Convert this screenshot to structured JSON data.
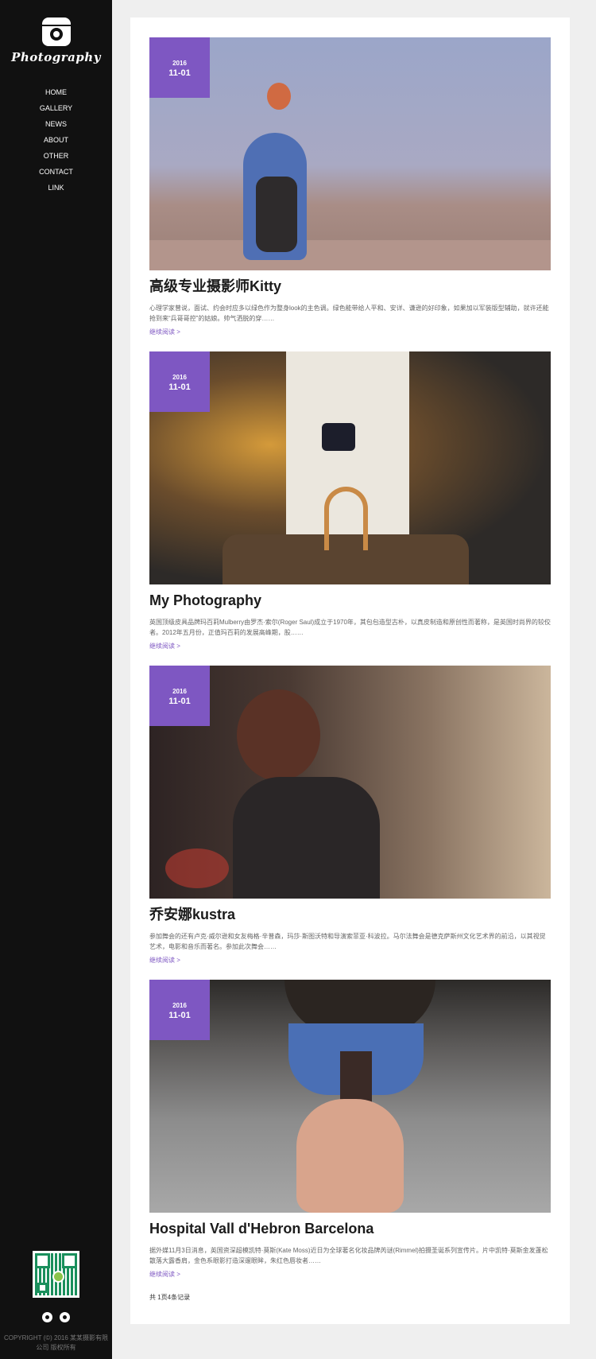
{
  "logo": {
    "text": "Photography"
  },
  "nav": [
    "HOME",
    "GALLERY",
    "NEWS",
    "ABOUT",
    "OTHER",
    "CONTACT",
    "LINK"
  ],
  "posts": [
    {
      "year": "2016",
      "date": "11-01",
      "title": "高级专业摄影师Kitty",
      "excerpt": "心理学家曾说，面试、约会时应多以绿色作为整身look的主色调。绿色能带给人平和、安详、谦逊的好印象，如果加以军装版型辅助，就许还能抢到来“兵哥哥控”的姑娘。帅气洒脱的穿……",
      "more": "继续阅读 >"
    },
    {
      "year": "2016",
      "date": "11-01",
      "title": "My Photography",
      "excerpt": "英国顶级皮具品牌玛百莉Mulberry由罗杰·索尔(Roger Saul)成立于1970年，其包包造型古朴，以真皮制造和原创性而著称，是英国时尚界的较佼者。2012年五月份，正值玛百莉的发展高峰期，股……",
      "more": "继续阅读 >"
    },
    {
      "year": "2016",
      "date": "11-01",
      "title": "乔安娜kustra",
      "excerpt": "参加舞会的还有卢克·威尔逊和女友梅格·辛普森，玛莎·斯图沃特和导演索菲亚·科波拉。马尔法舞会是德克萨斯州文化艺术界的前沿，以其视觉艺术，电影和音乐而著名。参加此次舞会……",
      "more": "继续阅读 >"
    },
    {
      "year": "2016",
      "date": "11-01",
      "title": "Hospital Vall d'Hebron Barcelona",
      "excerpt": "据外媒11月3日消息，英国资深超模凯特·莫斯(Kate Moss)近日为全球著名化妆品牌芮谜(Rimmel)拍摄圣诞系列宣传片。片中凯特·莫斯金发蓬松散落大露香肩，金色系眼影打造深邃眼眸，朱红色唇妆者……",
      "more": "继续阅读 >"
    }
  ],
  "pagination": "共 1页4条记录",
  "copyright": "COPYRIGHT (©) 2016 某某摄影有限公司 版权所有",
  "colors": {
    "accent": "#7e57c2",
    "sidebar": "#111111",
    "page_bg": "#efefef"
  },
  "icons": {
    "social": [
      "weibo-icon",
      "qq-icon"
    ]
  }
}
